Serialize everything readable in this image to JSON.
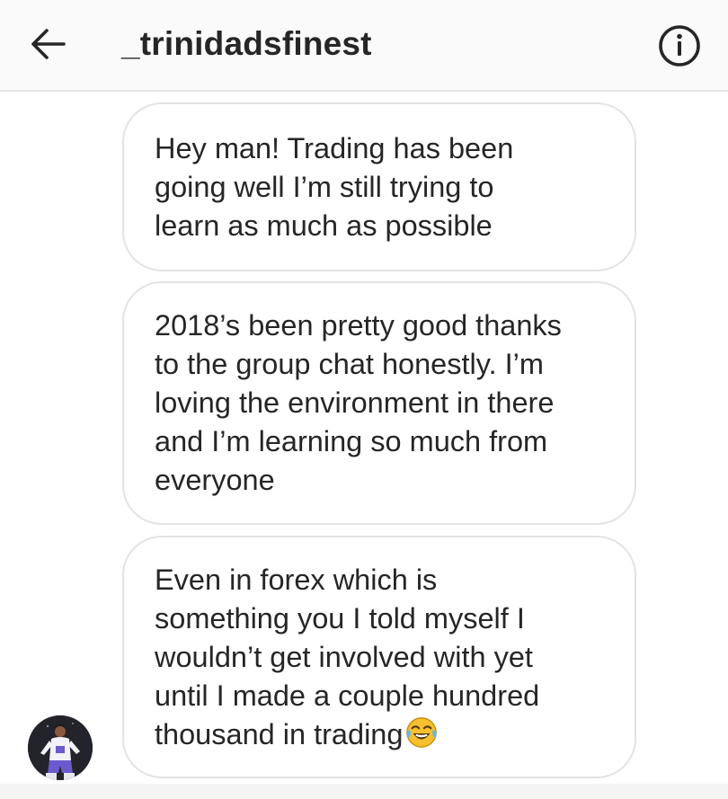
{
  "header": {
    "back_icon": "arrow-left-icon",
    "username": "_trinidadsfinest",
    "info_icon": "info-circle-icon"
  },
  "messages": [
    {
      "text": "Hey man! Trading has been\ngoing well I’m still trying to\nlearn as much as possible"
    },
    {
      "text": "2018’s been pretty good thanks\nto the group chat honestly. I’m\nloving the environment in there\nand I’m learning so much from\neveryone"
    },
    {
      "text": "Even in forex which is\nsomething you I told myself I\nwouldn’t get involved with yet\nuntil I made a couple hundred\nthousand in trading",
      "emoji": "face-with-tears-of-joy"
    }
  ],
  "sender": {
    "avatar_icon": "user-avatar"
  },
  "colors": {
    "header_bg": "#fafafa",
    "bubble_border": "#e3e3e3",
    "text": "#262626",
    "emoji": "#f7c02f"
  }
}
